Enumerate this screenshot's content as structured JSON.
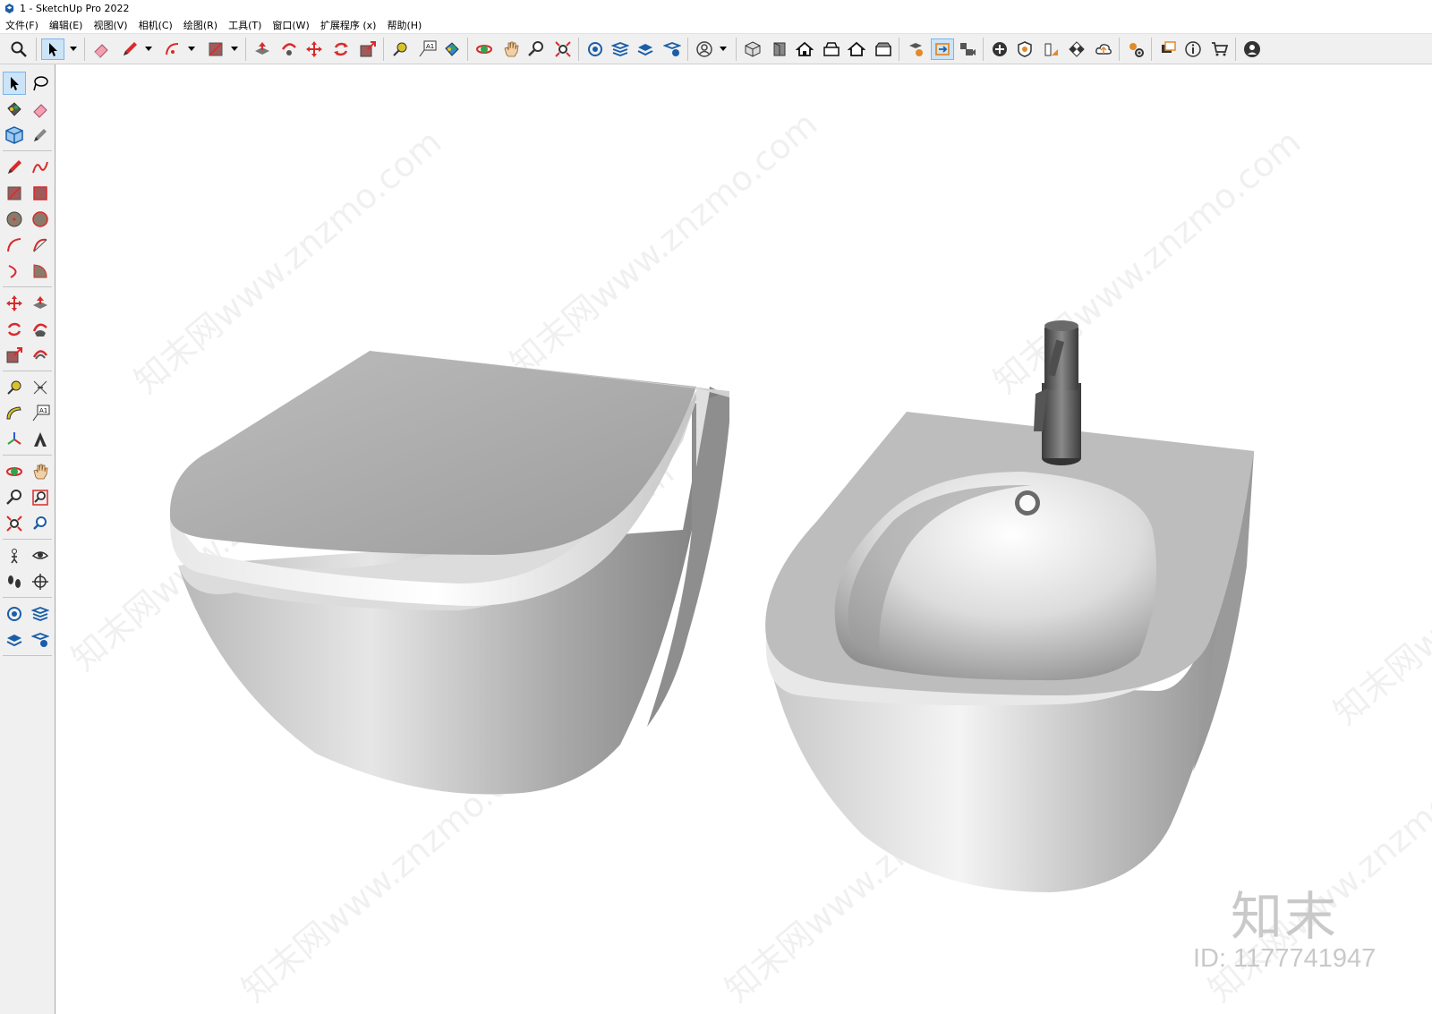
{
  "window": {
    "title": "1 - SketchUp Pro 2022"
  },
  "menu": [
    {
      "label": "文件(F)"
    },
    {
      "label": "编辑(E)"
    },
    {
      "label": "视图(V)"
    },
    {
      "label": "相机(C)"
    },
    {
      "label": "绘图(R)"
    },
    {
      "label": "工具(T)"
    },
    {
      "label": "窗口(W)"
    },
    {
      "label": "扩展程序 (x)"
    },
    {
      "label": "帮助(H)"
    }
  ],
  "toolbar": {
    "text_tool_glyph": "A1",
    "icons": [
      "search-icon",
      "select-icon",
      "eraser-icon",
      "pencil-icon",
      "arc-icon",
      "rectangle-icon",
      "push-pull-icon",
      "follow-me-icon",
      "move-icon",
      "rotate-icon",
      "scale-icon",
      "tape-measure-icon",
      "text-icon",
      "paint-bucket-icon",
      "orbit-icon",
      "pan-icon",
      "zoom-icon",
      "zoom-extents-icon",
      "warehouse-icon",
      "extension-icon",
      "account-icon",
      "home-icon",
      "info-icon",
      "cart-icon",
      "user-icon"
    ]
  },
  "sidebar": {
    "text_tool_glyph": "A1"
  },
  "viewport": {
    "watermark_text": "知末网www.znzmo.com",
    "logo_text": "知末",
    "id_label": "ID: 1177741947"
  },
  "colors": {
    "accent": "#cce4f7",
    "accent_border": "#7eb4ea",
    "red_tool": "#d92a2a",
    "toolbar_bg": "#f0f0f0"
  }
}
